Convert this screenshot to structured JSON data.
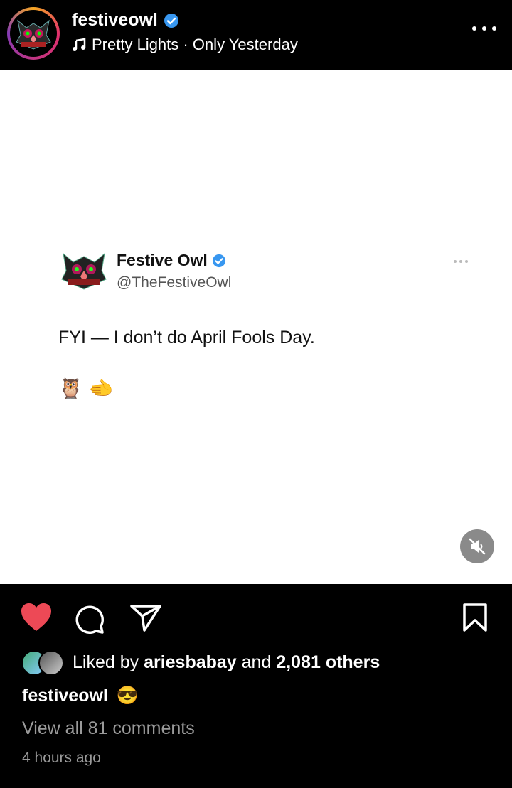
{
  "header": {
    "username": "festiveowl",
    "audio": "Pretty Lights · Only Yesterday"
  },
  "tweet": {
    "name": "Festive Owl",
    "handle": "@TheFestiveOwl",
    "text": "FYI — I don’t do April Fools Day.",
    "emoji": [
      "🦉",
      "🫲"
    ]
  },
  "engagement": {
    "likes_text": "Liked by ",
    "liker": "ariesbabay",
    "likes_mid": " and ",
    "likes_count": "2,081 others",
    "caption_user": "festiveowl",
    "caption_emoji": "😎",
    "view_comments": "View all 81 comments",
    "timestamp": "4 hours ago"
  },
  "colors": {
    "verified": "#3897f0",
    "like": "#ed4956"
  }
}
